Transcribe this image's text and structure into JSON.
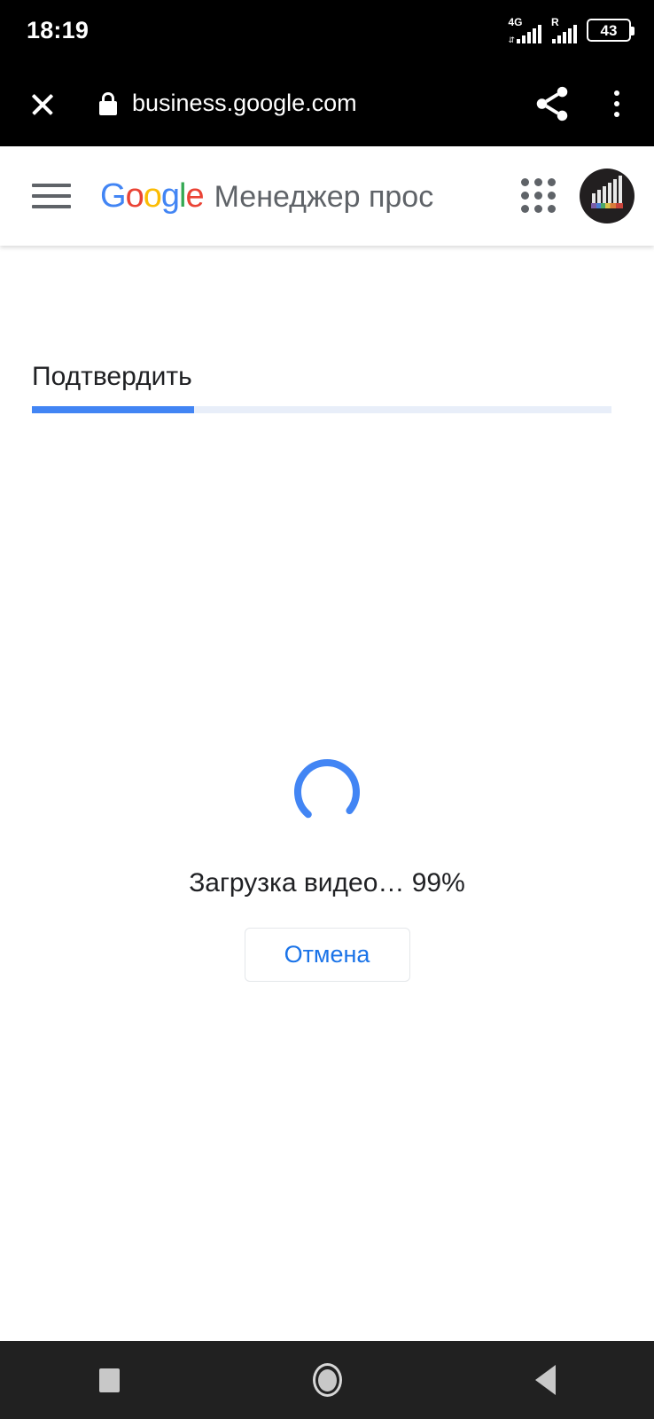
{
  "status_bar": {
    "time": "18:19",
    "network_label": "4G",
    "roaming_label": "R",
    "battery_percent": "43",
    "icons": {
      "signal": "signal-bars-icon",
      "roaming_signal": "roaming-signal-bars-icon",
      "battery": "battery-icon"
    }
  },
  "browser": {
    "close_label": "✕",
    "url": "business.google.com",
    "secure": true,
    "icons": {
      "close": "close-icon",
      "lock": "lock-icon",
      "share": "share-icon",
      "overflow": "more-vertical-icon"
    }
  },
  "app_header": {
    "menu_icon": "hamburger-menu-icon",
    "brand": {
      "letters": [
        "G",
        "o",
        "o",
        "g",
        "l",
        "e"
      ]
    },
    "product_name": "Менеджер проc",
    "apps_icon": "apps-grid-icon",
    "avatar_icon": "account-avatar"
  },
  "page": {
    "step_title": "Подтвердить",
    "progress": {
      "value": 28,
      "fill_color": "#4285F4",
      "track_color": "#e8eef9"
    },
    "loading": {
      "spinner_icon": "loading-spinner-icon",
      "spinner_color": "#4285F4",
      "text": "Загрузка видео… 99%",
      "percent": "99%",
      "cancel_label": "Отмена",
      "cancel_color": "#1a73e8"
    }
  },
  "nav_bar": {
    "recents_icon": "recents-square-icon",
    "home_icon": "home-circle-icon",
    "back_icon": "back-triangle-icon"
  }
}
